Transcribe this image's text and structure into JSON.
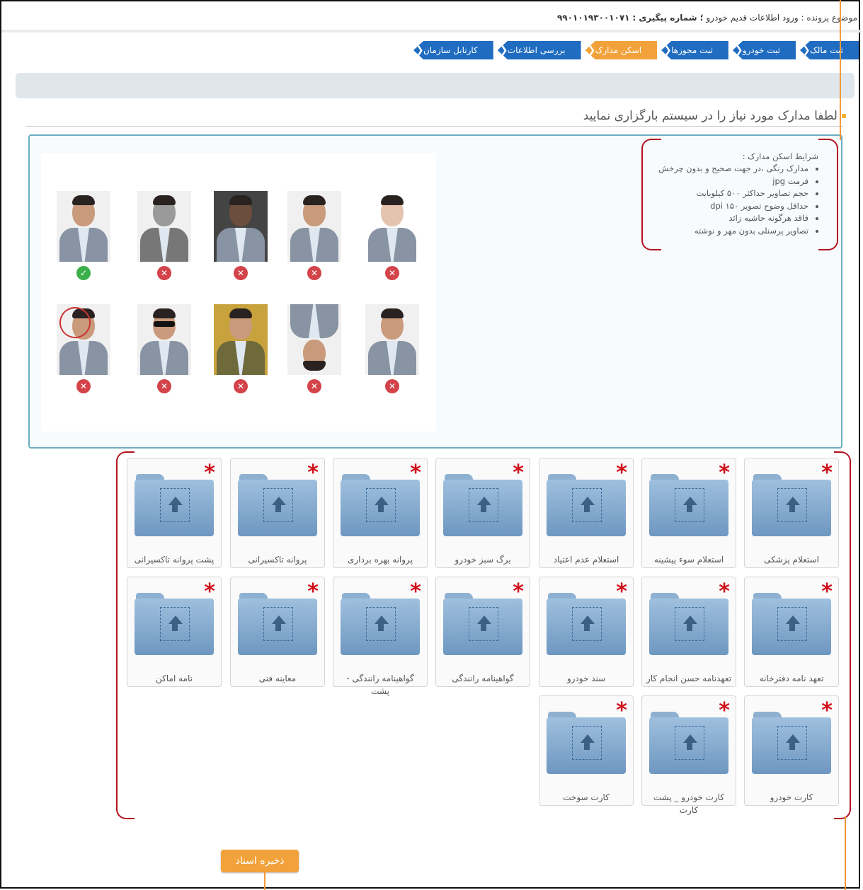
{
  "header": {
    "subject_label": "موضوع پرونده :",
    "subject_value": "ورود اطلاعات قدیم خودرو",
    "tracking_label": "؛ شماره پیگیری :",
    "tracking_value": "۹۹۰۱۰۱۹۳۰۰۱۰۷۱"
  },
  "steps": [
    {
      "label": "ثبت مالک"
    },
    {
      "label": "ثبت خودرو"
    },
    {
      "label": "ثبت مجوزها"
    },
    {
      "label": "اسکن مدارک"
    },
    {
      "label": "بررسی اطلاعات"
    },
    {
      "label": "کارتابل سازمان"
    }
  ],
  "instruction": "لطفا مدارک مورد نیاز را در سیستم بارگزاری نمایید",
  "conditions": {
    "title": "شرایط اسکن مدارک :",
    "items": [
      "مدارک رنگی ،در جهت صحیح و بدون چرخش",
      "فرمت jpg",
      "حجم تصاویر حداکثر ۵۰۰ کیلوبایت",
      "حداقل وضوح تصویر ۱۵۰ dpi",
      "فاقد هرگونه حاشیه زائد",
      "تصاویر پرسنلی بدون مهر و نوشته"
    ]
  },
  "photo_examples": [
    {
      "status": "ok"
    },
    {
      "status": "bad"
    },
    {
      "status": "bad"
    },
    {
      "status": "bad"
    },
    {
      "status": "bad"
    },
    {
      "status": "bad"
    },
    {
      "status": "bad"
    },
    {
      "status": "bad"
    },
    {
      "status": "bad"
    },
    {
      "status": "bad"
    }
  ],
  "documents": [
    "استعلام پزشکی",
    "استعلام سوء پیشینه",
    "استعلام عدم اعتیاد",
    "برگ سبز خودرو",
    "پروانه بهره برداری",
    "پروانه تاکسیرانی",
    "پشت پروانه تاکسیرانی",
    "تعهد نامه دفترخانه",
    "تعهدنامه حسن انجام کار",
    "سند خودرو",
    "گواهینامه رانندگی",
    "گواهینامه رانندگی - پشت",
    "معاینه فنی",
    "نامه اماکن",
    "کارت خودرو",
    "کارت خودرو _ پشت کارت",
    "کارت سوخت"
  ],
  "required_mark": "*",
  "save_button": "ذخیره اسناد",
  "colors": {
    "step_blue": "#1f6cc1",
    "step_active": "#f2a23a",
    "required": "#d0101a",
    "bracket": "#b4121f"
  }
}
